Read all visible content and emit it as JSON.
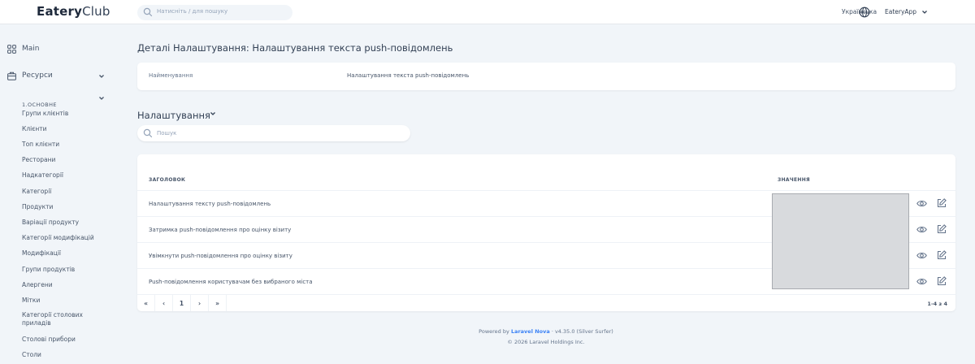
{
  "header": {
    "logo_bold": "Eatery",
    "logo_light": "Club",
    "search_placeholder": "Натисніть / для пошуку",
    "language": "Українська",
    "app_menu": "EateryApp"
  },
  "sidebar": {
    "main_label": "Main",
    "resources_label": "Ресурси",
    "group_label": "1.ОСНОВНЕ",
    "items": [
      "Групи клієнтів",
      "Клієнти",
      "Топ клієнти",
      "Ресторани",
      "Надкатегорії",
      "Категорії",
      "Продукти",
      "Варіації продукту",
      "Категорії модифікацій",
      "Модифікації",
      "Групи продуктів",
      "Алергени",
      "Мітки",
      "Категорії столових приладів",
      "Столові прибори",
      "Столи"
    ]
  },
  "main": {
    "title": "Деталі Налаштування: Налаштування текста push-повідомлень",
    "detail": {
      "key": "Найменування",
      "value": "Налаштування текста push-повідомлень"
    },
    "section_label": "Налаштування",
    "search_placeholder": "Пошук",
    "table": {
      "col_title": "ЗАГОЛОВОК",
      "col_value": "ЗНАЧЕННЯ",
      "rows": [
        "Налаштування тексту push-повідомлень",
        "Затримка push-повідомлення про оцінку візиту",
        "Увімкнути push-повідомлення про оцінку візиту",
        "Push-повідомлення користувачам без вибраного міста"
      ]
    },
    "pager": {
      "first": "«",
      "prev": "‹",
      "page": "1",
      "next": "›",
      "last": "»",
      "count": "1-4 з 4"
    }
  },
  "footer": {
    "powered_by": "Powered by",
    "nova_link": "Laravel Nova",
    "version": "· v4.35.0 (Silver Surfer)",
    "copyright": "© 2026 Laravel Holdings Inc."
  },
  "colors": {
    "background": "#f1f5f9",
    "link": "#3b82f6",
    "value_block": "#d8dadd"
  }
}
